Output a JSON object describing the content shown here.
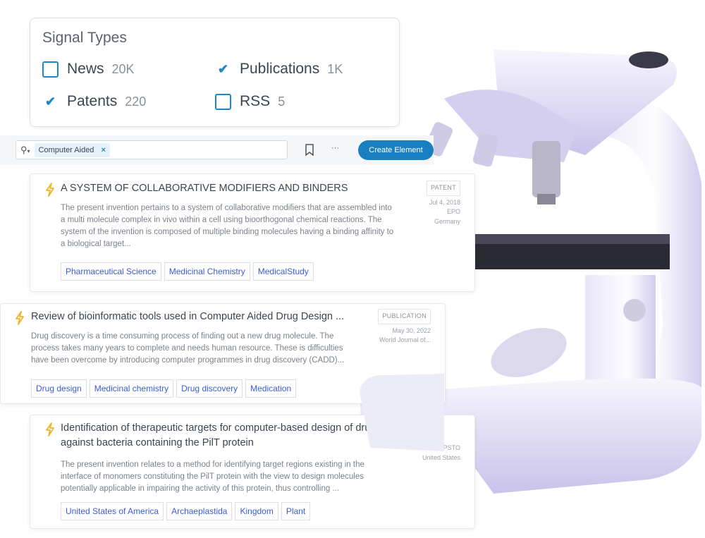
{
  "signal_types": {
    "title": "Signal Types",
    "options": [
      {
        "label": "News",
        "count": "20K",
        "checked": false
      },
      {
        "label": "Publications",
        "count": "1K",
        "checked": true
      },
      {
        "label": "Patents",
        "count": "220",
        "checked": true
      },
      {
        "label": "RSS",
        "count": "5",
        "checked": false
      }
    ]
  },
  "toolbar": {
    "search_chip": "Computer Aided",
    "chip_remove": "×",
    "create_label": "Create Element",
    "more_label": "···",
    "accent": "#1a7fc1"
  },
  "results": [
    {
      "title": "A SYSTEM OF COLLABORATIVE MODIFIERS AND BINDERS",
      "body": "The present invention pertains to a system of collaborative modifiers that are assembled into a multi molecule complex in vivo within a cell using bioorthogonal chemical reactions. The system of the invention is composed of multiple binding molecules having a binding affinity to a biological target...",
      "type": "PATENT",
      "date": "Jul 4, 2018",
      "source": "EPO",
      "country": "Germany",
      "tags": [
        "Pharmaceutical Science",
        "Medicinal Chemistry",
        "MedicalStudy"
      ]
    },
    {
      "title": "Review of bioinformatic tools used in Computer Aided Drug Design ...",
      "body": "Drug discovery is a time consuming process of finding out a new drug molecule. The process takes many years to complete and needs human resource. These is difficulties have been overcome by introducing computer programmes in drug discovery (CADD)...",
      "type": "PUBLICATION",
      "date": "May 30, 2022",
      "source": "World Journal of...",
      "tags": [
        "Drug design",
        "Medicinal chemistry",
        "Drug discovery",
        "Medication"
      ]
    },
    {
      "title": "Identification of therapeutic targets for computer-based design of drugs against bacteria containing the PilT protein",
      "body": "The present invention relates to a method for identifying target regions existing in the interface of monomers constituting the PilT protein with the view to design molecules potentially applicable in impairing the activity of this protein, thus controlling ...",
      "source": "UPSTO",
      "country": "United States",
      "tags": [
        "United States of America",
        "Archaeplastida",
        "Kingdom",
        "Plant"
      ]
    }
  ]
}
